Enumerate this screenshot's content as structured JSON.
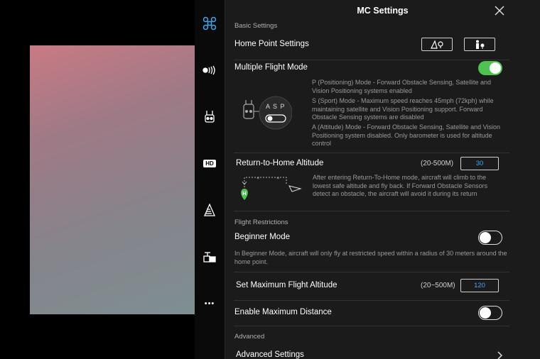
{
  "header": {
    "title": "MC Settings"
  },
  "sections": {
    "basic": "Basic Settings",
    "restrictions": "Flight Restrictions",
    "advanced": "Advanced"
  },
  "home_point": {
    "label": "Home Point Settings"
  },
  "flight_mode": {
    "label": "Multiple Flight Mode",
    "enabled": true,
    "switch_letters": "A S P",
    "desc_p": "P (Positioning) Mode - Forward Obstacle Sensing, Satellite and Vision Positioning systems enabled",
    "desc_s": "S (Sport) Mode - Maximum speed reaches 45mph (72kph) while maintaining satellite and Vision Positioning support. Forward Obstacle Sensing systems are disabled",
    "desc_a": "A (Attitude) Mode - Forward Obstacle Sensing, Satellite and Vision Positioning system disabled. Only barometer is used for altitude control"
  },
  "rth": {
    "label": "Return-to-Home Altitude",
    "range": "(20-500M)",
    "value": "30",
    "desc": "After entering Return-To-Home mode, aircraft will climb to the lowest safe altitude and fly back. If Forward Obstacle Sensors detect an obstacle, the aircraft will avoid it during its return"
  },
  "beginner": {
    "label": "Beginner Mode",
    "enabled": false,
    "desc": "In Beginner Mode, aircraft will only fly at restricted speed within a radius of 30 meters around the home point."
  },
  "max_altitude": {
    "label": "Set Maximum Flight Altitude",
    "range": "(20~500M)",
    "value": "120"
  },
  "max_distance": {
    "label": "Enable Maximum Distance",
    "enabled": false
  },
  "advanced_settings": {
    "label": "Advanced Settings"
  },
  "sidebar": {
    "hd_label": "HD",
    "more": "•••"
  },
  "colors": {
    "accent": "#4fc34f",
    "value_blue": "#3fa9f5",
    "panel_bg": "#1b1b1b"
  }
}
